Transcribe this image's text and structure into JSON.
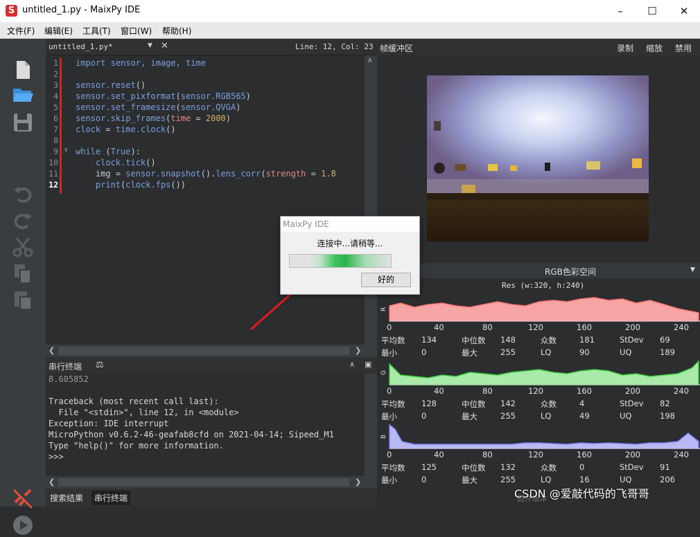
{
  "window": {
    "title": "untitled_1.py - MaixPy IDE",
    "logo": "S"
  },
  "menu": [
    "文件(F)",
    "编辑(E)",
    "工具(T)",
    "窗口(W)",
    "帮助(H)"
  ],
  "editor": {
    "tab": "untitled_1.py*",
    "position": "Line: 12, Col: 23",
    "line_numbers": [
      "1",
      "2",
      "3",
      "4",
      "5",
      "6",
      "7",
      "8",
      "9",
      "10",
      "11",
      "12"
    ]
  },
  "terminal": {
    "title": "串行终端",
    "lines": [
      "8.605852",
      "",
      "Traceback (most recent call last):",
      "  File \"<stdin>\", line 12, in <module>",
      "Exception: IDE interrupt",
      "MicroPython v0.6.2-46-geafab8cfd on 2021-04-14; Sipeed_M1",
      "Type \"help()\" for more information.",
      ">>>"
    ]
  },
  "bottom_tabs": [
    "搜索结果",
    "串行终端"
  ],
  "framebuffer": {
    "title": "帧缓冲区",
    "actions": [
      "录制",
      "缩放",
      "禁用"
    ]
  },
  "histogram": {
    "colorspace": "RGB色彩空间",
    "resolution": "Res (w:320, h:240)",
    "axis_ticks": [
      "0",
      "40",
      "80",
      "120",
      "160",
      "200",
      "240"
    ],
    "channels": [
      {
        "label": "R",
        "color": "#f4a0a0",
        "line": "#ff6a6a",
        "stats": {
          "mean": "134",
          "median": "148",
          "mode": "181",
          "stdev": "69",
          "min": "0",
          "max": "255",
          "lq": "90",
          "uq": "189"
        }
      },
      {
        "label": "G",
        "color": "#a6e8a6",
        "line": "#48d448",
        "stats": {
          "mean": "128",
          "median": "142",
          "mode": "4",
          "stdev": "82",
          "min": "0",
          "max": "255",
          "lq": "49",
          "uq": "198"
        }
      },
      {
        "label": "B",
        "color": "#b4b4f0",
        "line": "#7f7fff",
        "stats": {
          "mean": "125",
          "median": "132",
          "mode": "0",
          "stdev": "91",
          "min": "0",
          "max": "255",
          "lq": "16",
          "uq": "206"
        }
      }
    ],
    "stat_labels": {
      "mean": "平均数",
      "median": "中位数",
      "mode": "众数",
      "stdev": "StDev",
      "min": "最小",
      "max": "最大",
      "lq": "LQ",
      "uq": "UQ"
    }
  },
  "dialog": {
    "title": "MaixPy IDE",
    "message": "连接中...请稍等...",
    "ok": "好的"
  },
  "watermark": "CSDN @爱敲代码的飞哥哥",
  "footer_hint": "固件版本"
}
